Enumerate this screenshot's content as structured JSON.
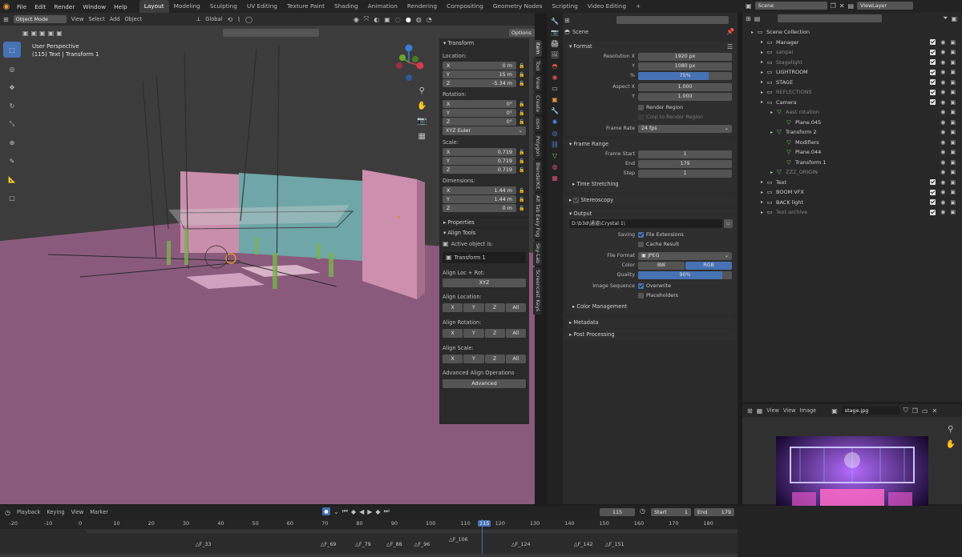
{
  "menu": [
    "File",
    "Edit",
    "Render",
    "Window",
    "Help"
  ],
  "workspaces": [
    "Layout",
    "Modeling",
    "Sculpting",
    "UV Editing",
    "Texture Paint",
    "Shading",
    "Animation",
    "Rendering",
    "Compositing",
    "Geometry Nodes",
    "Scripting",
    "Video Editing"
  ],
  "active_workspace": "Layout",
  "scene": {
    "label": "Scene",
    "view_layer": "ViewLayer"
  },
  "viewport": {
    "mode": "Object Mode",
    "view": "View",
    "select": "Select",
    "add": "Add",
    "object": "Object",
    "orientation": "Global",
    "options": "Options",
    "info_line1": "User Perspective",
    "info_line2": "(115) Text | Transform 1"
  },
  "npanel": {
    "transform_title": "Transform",
    "location_label": "Location:",
    "loc": [
      {
        "k": "X",
        "v": "0 m"
      },
      {
        "k": "Y",
        "v": "15 m"
      },
      {
        "k": "Z",
        "v": "-5.34 m"
      }
    ],
    "rotation_label": "Rotation:",
    "rot": [
      {
        "k": "X",
        "v": "0°"
      },
      {
        "k": "Y",
        "v": "0°"
      },
      {
        "k": "Z",
        "v": "0°"
      }
    ],
    "rot_mode": "XYZ Euler",
    "scale_label": "Scale:",
    "scale": [
      {
        "k": "X",
        "v": "0.719"
      },
      {
        "k": "Y",
        "v": "0.719"
      },
      {
        "k": "Z",
        "v": "0.719"
      }
    ],
    "dim_label": "Dimensions:",
    "dim": [
      {
        "k": "X",
        "v": "1.44 m"
      },
      {
        "k": "Y",
        "v": "1.44 m"
      },
      {
        "k": "Z",
        "v": "0 m"
      }
    ],
    "properties": "Properties",
    "align_tools": "Align Tools",
    "active_object_label": "Active object is:",
    "active_object": "Transform 1",
    "align_loc_rot": "Align Loc + Rot:",
    "xyz": "XYZ",
    "align_location": "Align Location:",
    "align_rotation": "Align Rotation:",
    "align_scale": "Align Scale:",
    "axes": [
      "X",
      "Y",
      "Z",
      "All"
    ],
    "advanced_ops": "Advanced Align Operations",
    "advanced": "Advanced",
    "tabs": [
      "Item",
      "Tool",
      "View",
      "Create",
      "osm",
      "Polygon",
      "BlenderKit",
      "Alt Tab Easy Fog",
      "Sky-Lab",
      "Screencast Keys"
    ]
  },
  "properties": {
    "scene_label": "Scene",
    "format": "Format",
    "res_x_label": "Resolution X",
    "res_x": "1920 px",
    "res_y_label": "Y",
    "res_y": "1080 px",
    "pct_label": "%",
    "pct": "75%",
    "pct_value": 75,
    "aspect_x_label": "Aspect X",
    "aspect_x": "1.000",
    "aspect_y_label": "Y",
    "aspect_y": "1.000",
    "render_region": "Render Region",
    "crop": "Crop to Render Region",
    "frame_rate_label": "Frame Rate",
    "frame_rate": "24 fps",
    "frame_range": "Frame Range",
    "frame_start_label": "Frame Start",
    "frame_start": "1",
    "end_label": "End",
    "end": "179",
    "step_label": "Step",
    "step": "1",
    "time_stretching": "Time Stretching",
    "stereoscopy": "Stereoscopy",
    "output": "Output",
    "output_path": "D:\\b3d\\通道\\Crystal 1\\",
    "saving_label": "Saving",
    "file_ext": "File Extensions",
    "cache": "Cache Result",
    "file_format_label": "File Format",
    "file_format": "JPEG",
    "color_label": "Color",
    "bw": "BW",
    "rgb": "RGB",
    "quality_label": "Quality",
    "quality": "90%",
    "quality_value": 90,
    "img_seq_label": "Image Sequence",
    "overwrite": "Overwrite",
    "placeholders": "Placeholders",
    "color_mgmt": "Color Management",
    "metadata": "Metadata",
    "post_processing": "Post Processing"
  },
  "outliner": {
    "rows": [
      {
        "name": "Scene Collection",
        "indent": 0,
        "dim": false
      },
      {
        "name": "Manager",
        "indent": 1,
        "dim": false
      },
      {
        "name": "sanpai",
        "indent": 1,
        "dim": true
      },
      {
        "name": "Stagelight",
        "indent": 1,
        "dim": true
      },
      {
        "name": "LIGHTROOM",
        "indent": 1,
        "dim": false
      },
      {
        "name": "STAGE",
        "indent": 1,
        "dim": false
      },
      {
        "name": "REFLECTIONS",
        "indent": 1,
        "dim": true
      },
      {
        "name": "Camera",
        "indent": 1,
        "dim": false
      },
      {
        "name": "Aast rotation",
        "indent": 2,
        "dim": true
      },
      {
        "name": "Plane.045",
        "indent": 3,
        "dim": false
      },
      {
        "name": "Transform 2",
        "indent": 2,
        "dim": false
      },
      {
        "name": "Modifiers",
        "indent": 3,
        "dim": false
      },
      {
        "name": "Plane.044",
        "indent": 3,
        "dim": false
      },
      {
        "name": "Transform 1",
        "indent": 3,
        "dim": false
      },
      {
        "name": "ZZZ_ORIGIN",
        "indent": 2,
        "dim": true
      },
      {
        "name": "Text",
        "indent": 1,
        "dim": false
      },
      {
        "name": "BOOM VFX",
        "indent": 1,
        "dim": false
      },
      {
        "name": "BACK light",
        "indent": 1,
        "dim": false
      },
      {
        "name": "Text archive",
        "indent": 1,
        "dim": true
      }
    ]
  },
  "image_editor": {
    "view": "View",
    "view2": "View",
    "image": "Image",
    "filename": "stage.jpg"
  },
  "timeline": {
    "playback": "Playback",
    "keying": "Keying",
    "view": "View",
    "marker": "Marker",
    "current": "115",
    "start_label": "Start",
    "start": "1",
    "end_label": "End",
    "end": "179",
    "ticks": [
      "-20",
      "-10",
      "0",
      "10",
      "20",
      "30",
      "40",
      "50",
      "60",
      "70",
      "80",
      "90",
      "100",
      "110",
      "115",
      "120",
      "130",
      "140",
      "150",
      "160",
      "170",
      "180"
    ],
    "markers": [
      "F_33",
      "F_69",
      "F_79",
      "F_88",
      "F_96",
      "F_106",
      "F_124",
      "F_142",
      "F_151"
    ]
  },
  "colors": {
    "accent": "#4772b3",
    "orange": "#e89a3a",
    "floor": "#8c5c7e",
    "wall": "#c78aa8",
    "cyan": "#6fa8a8"
  }
}
